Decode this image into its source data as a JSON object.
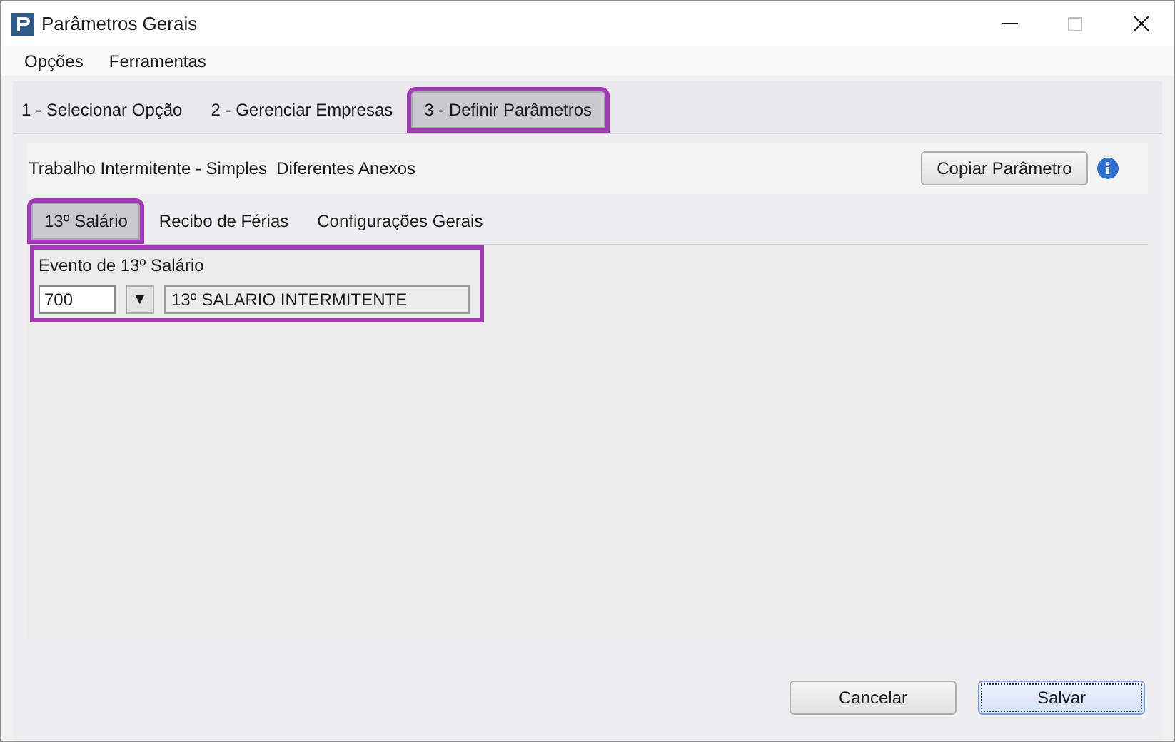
{
  "window": {
    "title": "Parâmetros Gerais"
  },
  "menu": [
    "Opções",
    "Ferramentas"
  ],
  "steps": [
    {
      "label": "1 - Selecionar Opção",
      "selected": false,
      "highlighted": false
    },
    {
      "label": "2 - Gerenciar Empresas",
      "selected": false,
      "highlighted": false
    },
    {
      "label": "3 - Definir Parâmetros",
      "selected": true,
      "highlighted": true
    }
  ],
  "heading": "Trabalho Intermitente - Simples  Diferentes Anexos",
  "copy_button": "Copiar Parâmetro",
  "tabs": [
    {
      "label": "13º Salário",
      "selected": true,
      "highlighted": true
    },
    {
      "label": "Recibo de Férias",
      "selected": false,
      "highlighted": false
    },
    {
      "label": "Configurações Gerais",
      "selected": false,
      "highlighted": false
    }
  ],
  "event": {
    "label": "Evento de 13º Salário",
    "code": "700",
    "dropdown": "▼",
    "description": "13º SALARIO INTERMITENTE",
    "highlighted": true
  },
  "buttons": [
    {
      "label": "Cancelar",
      "focused": false
    },
    {
      "label": "Salvar",
      "focused": true
    }
  ]
}
